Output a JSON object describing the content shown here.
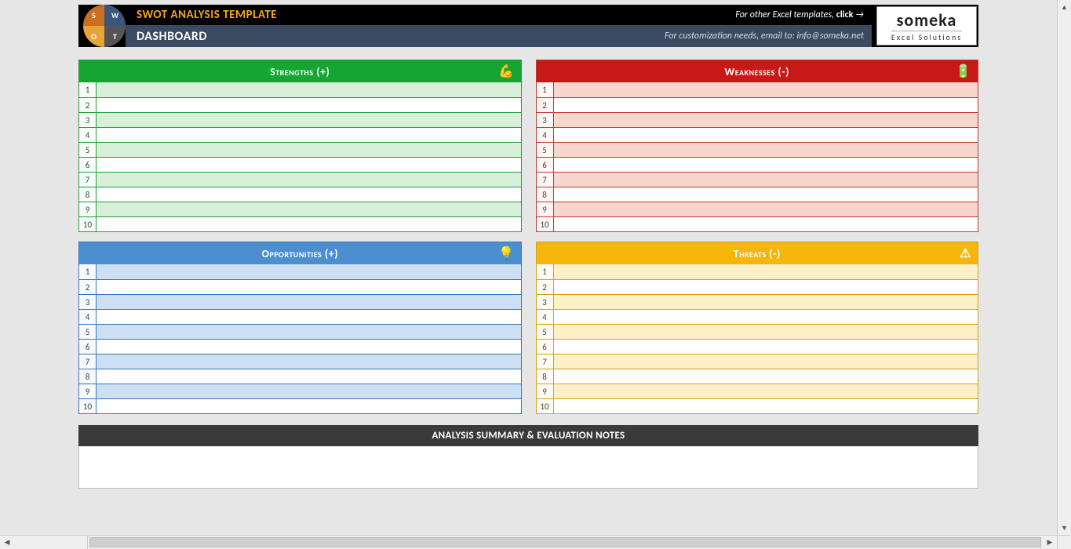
{
  "header": {
    "title": "SWOT ANALYSIS TEMPLATE",
    "dashboard": "DASHBOARD",
    "other_templates_prefix": "For other Excel templates, ",
    "other_templates_click": "click",
    "customization": "For customization needs, email to: info@someka.net",
    "brand_name": "someka",
    "brand_sub": "Excel Solutions",
    "logo": {
      "s": "S",
      "w": "W",
      "o": "O",
      "t": "T"
    }
  },
  "quadrants": {
    "strengths": {
      "label": "Strengths (+)",
      "rows": [
        "",
        "",
        "",
        "",
        "",
        "",
        "",
        "",
        "",
        ""
      ]
    },
    "weaknesses": {
      "label": "Weaknesses (-)",
      "rows": [
        "",
        "",
        "",
        "",
        "",
        "",
        "",
        "",
        "",
        ""
      ]
    },
    "opportunities": {
      "label": "Opportunities (+)",
      "rows": [
        "",
        "",
        "",
        "",
        "",
        "",
        "",
        "",
        "",
        ""
      ]
    },
    "threats": {
      "label": "Threats (-)",
      "rows": [
        "",
        "",
        "",
        "",
        "",
        "",
        "",
        "",
        "",
        ""
      ]
    }
  },
  "summary": {
    "header": "ANALYSIS SUMMARY & EVALUATION NOTES",
    "body": ""
  }
}
